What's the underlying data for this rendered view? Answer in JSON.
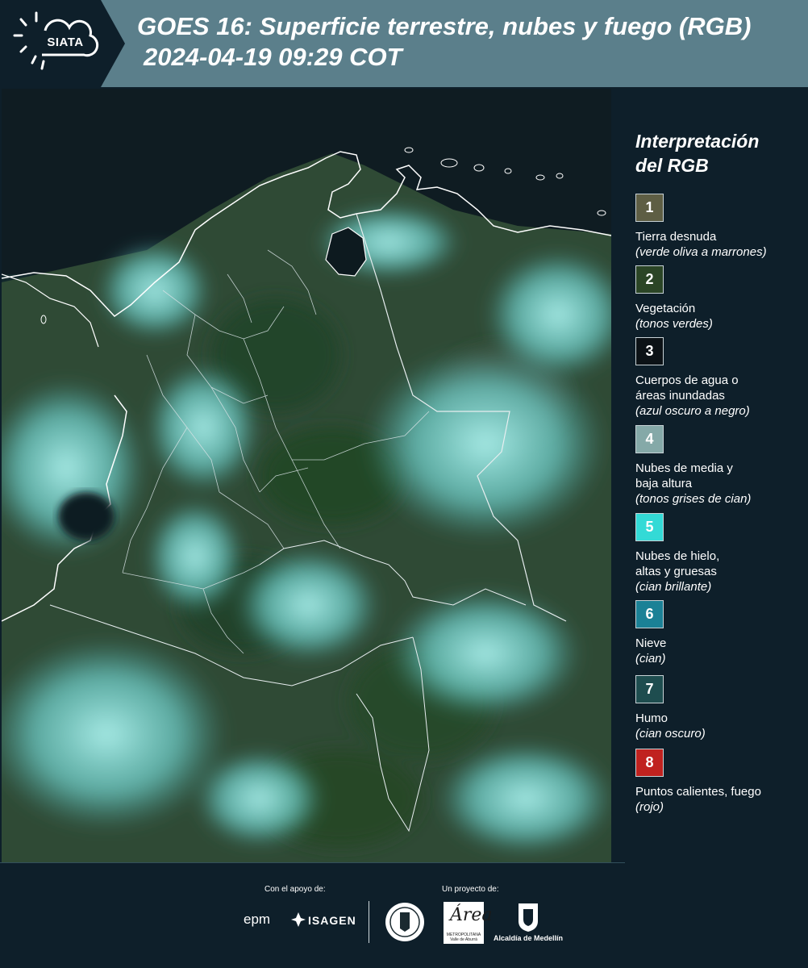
{
  "header": {
    "logo_text": "SIATA",
    "title_line1": "GOES 16: Superficie terrestre, nubes y fuego (RGB)",
    "title_line2": "2024-04-19 09:29 COT",
    "colors": {
      "header_bg": "#5b7f8b",
      "logo_bg": "#0e1f2a"
    }
  },
  "map": {
    "description_icon": "satellite-rgb-image"
  },
  "legend": {
    "title": "Interpretación del RGB",
    "items": [
      {
        "number": "1",
        "label": "Tierra desnuda",
        "note": "(verde oliva a marrones)",
        "color": "#5e5e44"
      },
      {
        "number": "2",
        "label": "Vegetación",
        "note": "(tonos verdes)",
        "color": "#2b4526"
      },
      {
        "number": "3",
        "label": "Cuerpos de agua o áreas inundadas",
        "note": "(azul oscuro a negro)",
        "color": "#0c1216"
      },
      {
        "number": "4",
        "label": "Nubes de media y baja altura",
        "note": "(tonos grises de cian)",
        "color": "#85a9a8"
      },
      {
        "number": "5",
        "label": "Nubes de hielo, altas y gruesas",
        "note": "(cian brillante)",
        "color": "#33dad6"
      },
      {
        "number": "6",
        "label": "Nieve",
        "note": "(cian)",
        "color": "#1b8196"
      },
      {
        "number": "7",
        "label": "Humo",
        "note": "(cian oscuro)",
        "color": "#1e4d4f"
      },
      {
        "number": "8",
        "label": "Puntos calientes, fuego",
        "note": "(rojo)",
        "color": "#c0221f"
      }
    ]
  },
  "footer": {
    "support_label": "Con el apoyo de:",
    "project_label": "Un proyecto de:",
    "epm": "epm",
    "isagen": "ISAGEN",
    "area_big": "Área",
    "area_small": "METROPOLITANA Valle de Aburrá",
    "medellin": "Alcaldía de Medellín"
  }
}
